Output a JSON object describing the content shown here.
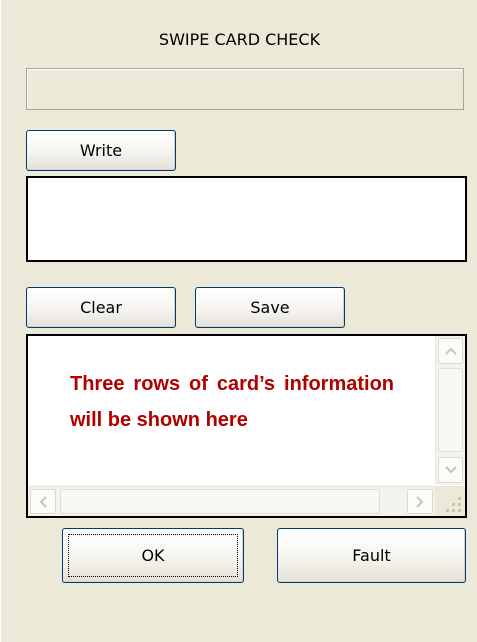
{
  "dialog": {
    "title": "SWIPE CARD CHECK",
    "status_field_value": ""
  },
  "write_section": {
    "write_label": "Write",
    "input_value": ""
  },
  "actions": {
    "clear_label": "Clear",
    "save_label": "Save"
  },
  "info_box": {
    "text": "Three rows of card’s information will be shown here",
    "text_color": "#b00000",
    "scroll_up_icon": "chevron-up-icon",
    "scroll_down_icon": "chevron-down-icon",
    "scroll_left_icon": "chevron-left-icon",
    "scroll_right_icon": "chevron-right-icon"
  },
  "footer": {
    "ok_label": "OK",
    "fault_label": "Fault"
  },
  "colors": {
    "dialog_bg": "#ece9d8",
    "button_border": "#003c74"
  }
}
